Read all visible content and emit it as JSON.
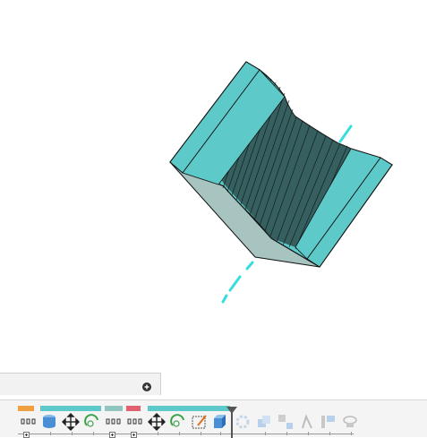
{
  "viewport": {
    "model_name": "extruded-channel-body",
    "colors": {
      "face": "#5ec9c9",
      "side": "#a8c4c0",
      "edge": "#111111",
      "axis": "#38dede"
    }
  },
  "comments": {
    "add_icon": "plus-circle-icon"
  },
  "timeline": {
    "feature_bar_colors": [
      "#f0a040",
      "#5ec9c9",
      "#8fc6c0",
      "#e06070",
      "#5ec9c9"
    ],
    "items": [
      {
        "name": "sketch",
        "icon": "sketch-grid-icon",
        "state": "active"
      },
      {
        "name": "extrude",
        "icon": "extrude-body-icon",
        "state": "active"
      },
      {
        "name": "move",
        "icon": "move-arrows-icon",
        "state": "active"
      },
      {
        "name": "revolve",
        "icon": "revolve-icon",
        "state": "active"
      },
      {
        "name": "sketch-2",
        "icon": "sketch-grid-icon",
        "state": "active"
      },
      {
        "name": "sketch-3",
        "icon": "sketch-grid-icon",
        "state": "active"
      },
      {
        "name": "move-2",
        "icon": "move-arrows-icon",
        "state": "active"
      },
      {
        "name": "revolve-2",
        "icon": "revolve-icon",
        "state": "active"
      },
      {
        "name": "sketch-edit",
        "icon": "sketch-edit-icon",
        "state": "active"
      },
      {
        "name": "body",
        "icon": "body-box-icon",
        "state": "active"
      },
      {
        "name": "circular-pattern",
        "icon": "pattern-icon",
        "state": "suppressed"
      },
      {
        "name": "combine",
        "icon": "combine-icon",
        "state": "suppressed"
      },
      {
        "name": "split",
        "icon": "split-icon",
        "state": "suppressed"
      },
      {
        "name": "thicken",
        "icon": "thicken-icon",
        "state": "suppressed"
      },
      {
        "name": "offset-plane",
        "icon": "plane-icon",
        "state": "suppressed"
      },
      {
        "name": "joint",
        "icon": "joint-icon",
        "state": "suppressed"
      }
    ],
    "marker_icon": "timeline-marker-icon"
  }
}
